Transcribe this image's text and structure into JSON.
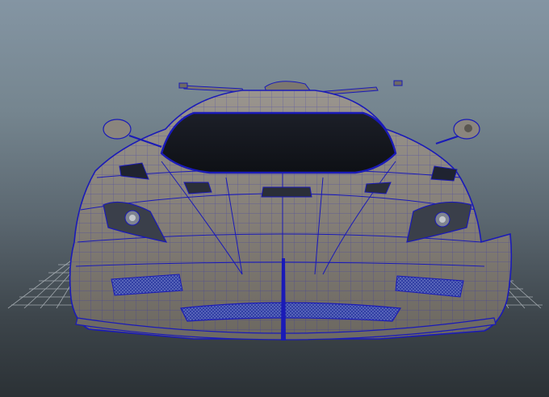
{
  "viewport": {
    "background_top": "#8495a3",
    "background_bottom": "#2b3135",
    "grid_color": "#c9cfd4",
    "wire_color": "#1a1ab8",
    "surface_color": "#8a857e",
    "surface_shadow": "#6e6a64",
    "glass_color": "#14161c",
    "mesh_grille_color": "#2a3a9a"
  }
}
